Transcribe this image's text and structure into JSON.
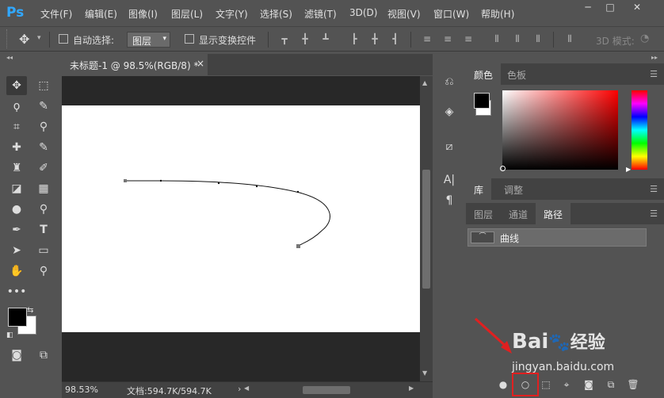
{
  "app": {
    "logo": "Ps"
  },
  "menu": [
    "文件(F)",
    "编辑(E)",
    "图像(I)",
    "图层(L)",
    "文字(Y)",
    "选择(S)",
    "滤镜(T)",
    "3D(D)",
    "视图(V)",
    "窗口(W)",
    "帮助(H)"
  ],
  "window_controls": {
    "minimize": "─",
    "restore": "□",
    "close": "✕"
  },
  "options": {
    "auto_select_label": "自动选择:",
    "auto_select_value": "图层",
    "show_transform_label": "显示变换控件",
    "mode_3d_label": "3D 模式:"
  },
  "document": {
    "tab_title": "未标题-1 @ 98.5%(RGB/8) *",
    "close": "×"
  },
  "status": {
    "zoom": "98.53%",
    "doc_info": "文档:594.7K/594.7K"
  },
  "panels": {
    "color_tabs": [
      "颜色",
      "色板"
    ],
    "lib_tabs": [
      "库",
      "调整"
    ],
    "layer_tabs": [
      "图层",
      "通道",
      "路径"
    ],
    "path_name": "曲线"
  },
  "watermark": {
    "brand": "Bai",
    "brand2": "经验",
    "url": "jingyan.baidu.com"
  },
  "colors": {
    "accent": "#31a8ff",
    "highlight": "#e02020",
    "fg": "#000000",
    "bg": "#ffffff"
  }
}
